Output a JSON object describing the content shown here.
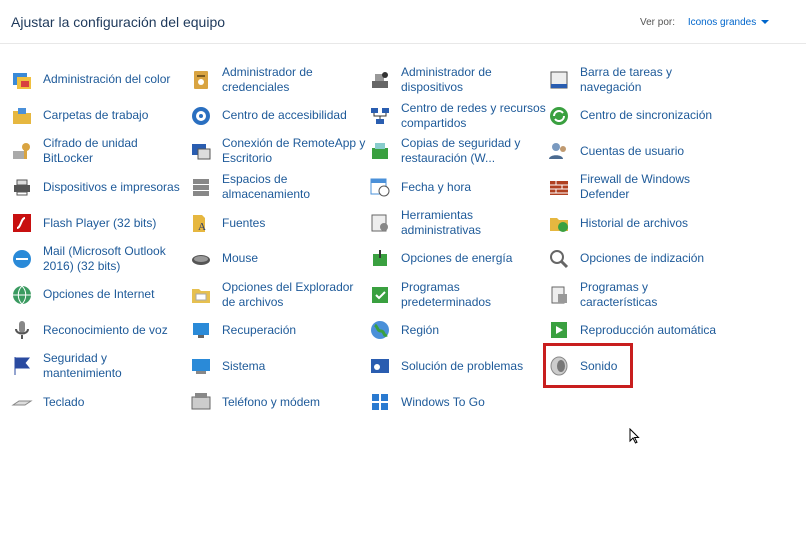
{
  "header": {
    "title": "Ajustar la configuración del equipo",
    "view_by_label": "Ver por:",
    "view_by_value": "Iconos grandes"
  },
  "colors": {
    "link": "#1e5a99",
    "title": "#1e395b",
    "highlight": "#c81e1e"
  },
  "items": [
    {
      "label": "Administración del color",
      "icon": "color-management-icon"
    },
    {
      "label": "Administrador de\ncredenciales",
      "icon": "credential-manager-icon"
    },
    {
      "label": "Administrador de\ndispositivos",
      "icon": "device-manager-icon"
    },
    {
      "label": "Barra de tareas y\nnavegación",
      "icon": "taskbar-icon"
    },
    {
      "label": "Carpetas de trabajo",
      "icon": "work-folders-icon"
    },
    {
      "label": "Centro de accesibilidad",
      "icon": "ease-of-access-icon"
    },
    {
      "label": "Centro de redes y recursos\ncompartidos",
      "icon": "network-center-icon"
    },
    {
      "label": "Centro de sincronización",
      "icon": "sync-center-icon"
    },
    {
      "label": "Cifrado de unidad\nBitLocker",
      "icon": "bitlocker-icon"
    },
    {
      "label": "Conexión de RemoteApp y\nEscritorio",
      "icon": "remoteapp-icon"
    },
    {
      "label": "Copias de seguridad y\nrestauración (W...",
      "icon": "backup-restore-icon"
    },
    {
      "label": "Cuentas de usuario",
      "icon": "user-accounts-icon"
    },
    {
      "label": "Dispositivos e impresoras",
      "icon": "devices-printers-icon"
    },
    {
      "label": "Espacios de\nalmacenamiento",
      "icon": "storage-spaces-icon"
    },
    {
      "label": "Fecha y hora",
      "icon": "date-time-icon"
    },
    {
      "label": "Firewall de Windows\nDefender",
      "icon": "firewall-icon"
    },
    {
      "label": "Flash Player (32 bits)",
      "icon": "flash-player-icon"
    },
    {
      "label": "Fuentes",
      "icon": "fonts-icon"
    },
    {
      "label": "Herramientas\nadministrativas",
      "icon": "admin-tools-icon"
    },
    {
      "label": "Historial de archivos",
      "icon": "file-history-icon"
    },
    {
      "label": "Mail (Microsoft Outlook\n2016) (32 bits)",
      "icon": "mail-icon"
    },
    {
      "label": "Mouse",
      "icon": "mouse-icon"
    },
    {
      "label": "Opciones de energía",
      "icon": "power-options-icon"
    },
    {
      "label": "Opciones de indización",
      "icon": "indexing-options-icon"
    },
    {
      "label": "Opciones de Internet",
      "icon": "internet-options-icon"
    },
    {
      "label": "Opciones del Explorador\nde archivos",
      "icon": "file-explorer-options-icon"
    },
    {
      "label": "Programas\npredeterminados",
      "icon": "default-programs-icon"
    },
    {
      "label": "Programas y\ncaracterísticas",
      "icon": "programs-features-icon"
    },
    {
      "label": "Reconocimiento de voz",
      "icon": "speech-recognition-icon"
    },
    {
      "label": "Recuperación",
      "icon": "recovery-icon"
    },
    {
      "label": "Región",
      "icon": "region-icon"
    },
    {
      "label": "Reproducción automática",
      "icon": "autoplay-icon"
    },
    {
      "label": "Seguridad y\nmantenimiento",
      "icon": "security-maintenance-icon"
    },
    {
      "label": "Sistema",
      "icon": "system-icon"
    },
    {
      "label": "Solución de problemas",
      "icon": "troubleshooting-icon"
    },
    {
      "label": "Sonido",
      "icon": "sound-icon"
    },
    {
      "label": "Teclado",
      "icon": "keyboard-icon"
    },
    {
      "label": "Teléfono y módem",
      "icon": "phone-modem-icon"
    },
    {
      "label": "Windows To Go",
      "icon": "windows-to-go-icon"
    }
  ]
}
